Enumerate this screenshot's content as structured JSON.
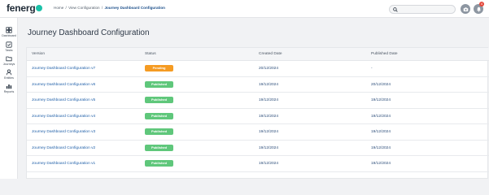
{
  "header": {
    "logo_text": "fenerg",
    "breadcrumb": [
      "Home",
      "View Configuration",
      "Journey Dashboard Configuration"
    ],
    "breadcrumb_sep": "/",
    "notification_count": "4"
  },
  "sidebar": {
    "items": [
      {
        "label": "Dashboard",
        "icon": "dashboard-icon"
      },
      {
        "label": "Tasks",
        "icon": "tasks-icon"
      },
      {
        "label": "Journeys",
        "icon": "journeys-icon"
      },
      {
        "label": "Entities",
        "icon": "entities-icon"
      },
      {
        "label": "Reports",
        "icon": "reports-icon"
      }
    ]
  },
  "page": {
    "title": "Journey Dashboard Configuration"
  },
  "table": {
    "columns": [
      "Version",
      "Status",
      "Created Date",
      "Published Date"
    ],
    "rows": [
      {
        "version": "Journey Dashboard Configuration v7",
        "status": "Pending",
        "created": "20/12/2024",
        "published": "-"
      },
      {
        "version": "Journey Dashboard Configuration v6",
        "status": "Published",
        "created": "19/12/2024",
        "published": "20/12/2024"
      },
      {
        "version": "Journey Dashboard Configuration v5",
        "status": "Published",
        "created": "19/12/2024",
        "published": "19/12/2024"
      },
      {
        "version": "Journey Dashboard Configuration v4",
        "status": "Published",
        "created": "19/12/2024",
        "published": "19/12/2024"
      },
      {
        "version": "Journey Dashboard Configuration v3",
        "status": "Published",
        "created": "19/12/2024",
        "published": "19/12/2024"
      },
      {
        "version": "Journey Dashboard Configuration v2",
        "status": "Published",
        "created": "19/12/2024",
        "published": "19/12/2024"
      },
      {
        "version": "Journey Dashboard Configuration v1",
        "status": "Published",
        "created": "19/12/2024",
        "published": "19/12/2024"
      }
    ]
  },
  "colors": {
    "pending": "#f59b23",
    "published": "#5fc77b",
    "brand_accent": "#1bc1a8",
    "link": "#1f5fa8"
  }
}
